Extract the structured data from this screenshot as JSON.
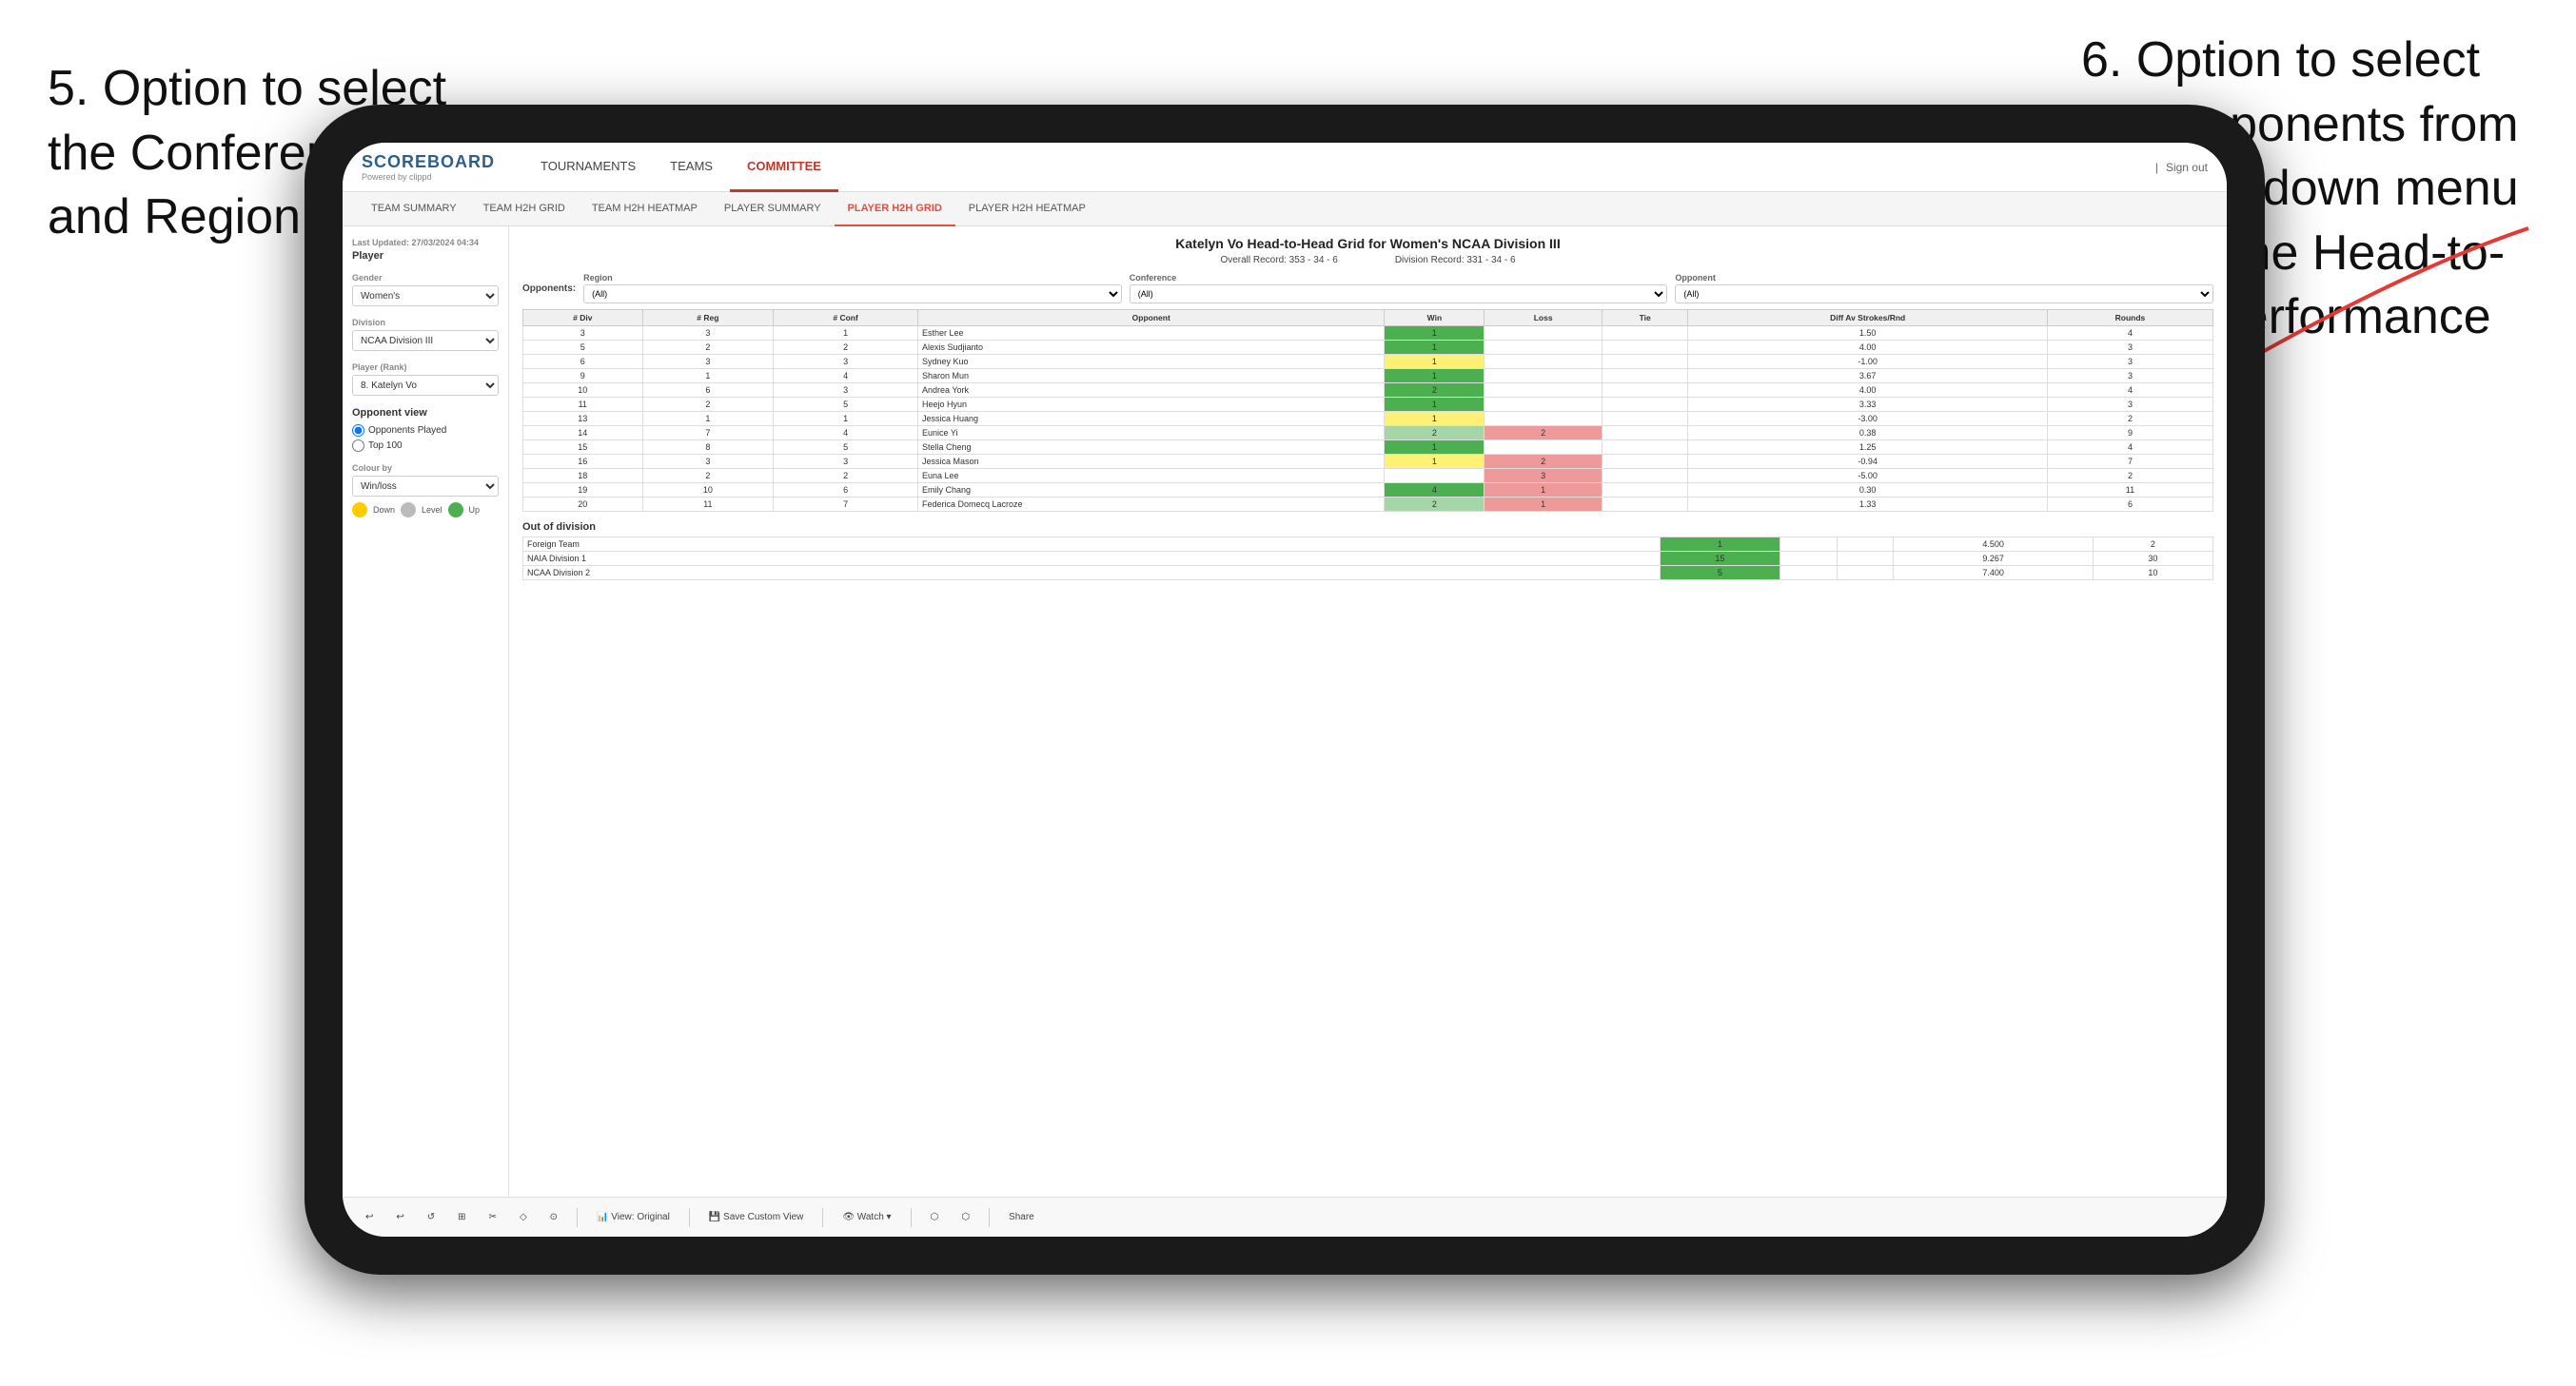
{
  "annotations": {
    "left": {
      "text": "5. Option to select the Conference and Region"
    },
    "right": {
      "text": "6. Option to select the Opponents from the dropdown menu to see the Head-to-Head performance"
    }
  },
  "nav": {
    "logo": "SCOREBOARD",
    "logo_sub": "Powered by clippd",
    "items": [
      "TOURNAMENTS",
      "TEAMS",
      "COMMITTEE"
    ],
    "active_item": "COMMITTEE",
    "sign_out": "Sign out"
  },
  "sub_nav": {
    "items": [
      "TEAM SUMMARY",
      "TEAM H2H GRID",
      "TEAM H2H HEATMAP",
      "PLAYER SUMMARY",
      "PLAYER H2H GRID",
      "PLAYER H2H HEATMAP"
    ],
    "active_item": "PLAYER H2H GRID"
  },
  "sidebar": {
    "last_updated": "Last Updated: 27/03/2024 04:34",
    "player_label": "Player",
    "gender_label": "Gender",
    "gender_value": "Women's",
    "division_label": "Division",
    "division_value": "NCAA Division III",
    "player_rank_label": "Player (Rank)",
    "player_rank_value": "8. Katelyn Vo",
    "opponent_view_label": "Opponent view",
    "opponent_options": [
      "Opponents Played",
      "Top 100"
    ],
    "colour_by_label": "Colour by",
    "colour_by_value": "Win/loss",
    "colour_labels": [
      "Down",
      "Level",
      "Up"
    ]
  },
  "main": {
    "title": "Katelyn Vo Head-to-Head Grid for Women's NCAA Division III",
    "overall_record": "Overall Record: 353 - 34 - 6",
    "division_record": "Division Record: 331 - 34 - 6",
    "filter": {
      "opponents_label": "Opponents:",
      "region_label": "Region",
      "region_value": "(All)",
      "conference_label": "Conference",
      "conference_value": "(All)",
      "opponent_label": "Opponent",
      "opponent_value": "(All)"
    },
    "table_headers": [
      "# Div",
      "# Reg",
      "# Conf",
      "Opponent",
      "Win",
      "Loss",
      "Tie",
      "Diff Av Strokes/Rnd",
      "Rounds"
    ],
    "rows": [
      {
        "div": "3",
        "reg": "3",
        "conf": "1",
        "opponent": "Esther Lee",
        "win": "1",
        "loss": "",
        "tie": "",
        "diff": "1.50",
        "rounds": "4",
        "win_color": "green_dark",
        "loss_color": "white",
        "tie_color": "white"
      },
      {
        "div": "5",
        "reg": "2",
        "conf": "2",
        "opponent": "Alexis Sudjianto",
        "win": "1",
        "loss": "",
        "tie": "",
        "diff": "4.00",
        "rounds": "3",
        "win_color": "green_dark",
        "loss_color": "white",
        "tie_color": "white"
      },
      {
        "div": "6",
        "reg": "3",
        "conf": "3",
        "opponent": "Sydney Kuo",
        "win": "1",
        "loss": "",
        "tie": "",
        "diff": "-1.00",
        "rounds": "3",
        "win_color": "yellow",
        "loss_color": "white",
        "tie_color": "white"
      },
      {
        "div": "9",
        "reg": "1",
        "conf": "4",
        "opponent": "Sharon Mun",
        "win": "1",
        "loss": "",
        "tie": "",
        "diff": "3.67",
        "rounds": "3",
        "win_color": "green_dark",
        "loss_color": "white",
        "tie_color": "white"
      },
      {
        "div": "10",
        "reg": "6",
        "conf": "3",
        "opponent": "Andrea York",
        "win": "2",
        "loss": "",
        "tie": "",
        "diff": "4.00",
        "rounds": "4",
        "win_color": "green_dark",
        "loss_color": "white",
        "tie_color": "white"
      },
      {
        "div": "11",
        "reg": "2",
        "conf": "5",
        "opponent": "Heejo Hyun",
        "win": "1",
        "loss": "",
        "tie": "",
        "diff": "3.33",
        "rounds": "3",
        "win_color": "green_dark",
        "loss_color": "white",
        "tie_color": "white"
      },
      {
        "div": "13",
        "reg": "1",
        "conf": "1",
        "opponent": "Jessica Huang",
        "win": "1",
        "loss": "",
        "tie": "",
        "diff": "-3.00",
        "rounds": "2",
        "win_color": "yellow",
        "loss_color": "white",
        "tie_color": "white"
      },
      {
        "div": "14",
        "reg": "7",
        "conf": "4",
        "opponent": "Eunice Yi",
        "win": "2",
        "loss": "2",
        "tie": "",
        "diff": "0.38",
        "rounds": "9",
        "win_color": "green_light",
        "loss_color": "red",
        "tie_color": "white"
      },
      {
        "div": "15",
        "reg": "8",
        "conf": "5",
        "opponent": "Stella Cheng",
        "win": "1",
        "loss": "",
        "tie": "",
        "diff": "1.25",
        "rounds": "4",
        "win_color": "green_dark",
        "loss_color": "white",
        "tie_color": "white"
      },
      {
        "div": "16",
        "reg": "3",
        "conf": "3",
        "opponent": "Jessica Mason",
        "win": "1",
        "loss": "2",
        "tie": "",
        "diff": "-0.94",
        "rounds": "7",
        "win_color": "yellow",
        "loss_color": "red",
        "tie_color": "white"
      },
      {
        "div": "18",
        "reg": "2",
        "conf": "2",
        "opponent": "Euna Lee",
        "win": "",
        "loss": "3",
        "tie": "",
        "diff": "-5.00",
        "rounds": "2",
        "win_color": "white",
        "loss_color": "red",
        "tie_color": "white"
      },
      {
        "div": "19",
        "reg": "10",
        "conf": "6",
        "opponent": "Emily Chang",
        "win": "4",
        "loss": "1",
        "tie": "",
        "diff": "0.30",
        "rounds": "11",
        "win_color": "green_dark",
        "loss_color": "red",
        "tie_color": "white"
      },
      {
        "div": "20",
        "reg": "11",
        "conf": "7",
        "opponent": "Federica Domecq Lacroze",
        "win": "2",
        "loss": "1",
        "tie": "",
        "diff": "1.33",
        "rounds": "6",
        "win_color": "green_light",
        "loss_color": "red",
        "tie_color": "white"
      }
    ],
    "out_of_division_title": "Out of division",
    "out_of_division_rows": [
      {
        "name": "Foreign Team",
        "win": "1",
        "loss": "",
        "tie": "",
        "diff": "4.500",
        "rounds": "2",
        "win_color": "green_dark"
      },
      {
        "name": "NAIA Division 1",
        "win": "15",
        "loss": "",
        "tie": "",
        "diff": "9.267",
        "rounds": "30",
        "win_color": "green_dark"
      },
      {
        "name": "NCAA Division 2",
        "win": "5",
        "loss": "",
        "tie": "",
        "diff": "7.400",
        "rounds": "10",
        "win_color": "green_dark"
      }
    ]
  },
  "toolbar": {
    "buttons": [
      "↩",
      "↩",
      "↺",
      "⊞",
      "✂",
      "⬡",
      "⊙",
      "View: Original",
      "Save Custom View",
      "Watch ▾",
      "⬡",
      "⬡",
      "Share"
    ]
  }
}
